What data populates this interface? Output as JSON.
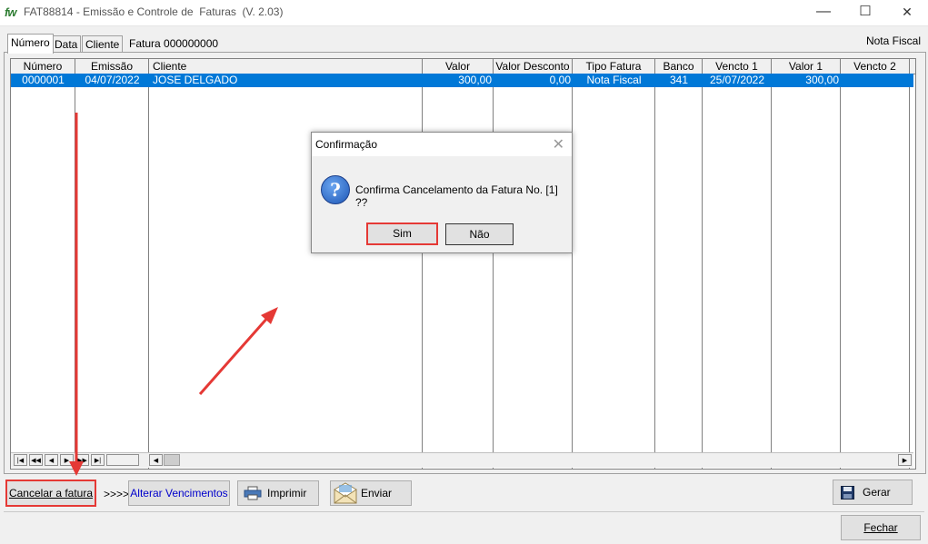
{
  "window": {
    "logo": "fw",
    "title": "FAT88814 - Emissão e Controle de  Faturas  (V. 2.03)",
    "minimize": "—",
    "maximize": "☐",
    "close": "✕"
  },
  "tabs": [
    {
      "label": "Número"
    },
    {
      "label": "Data"
    },
    {
      "label": "Cliente"
    }
  ],
  "fatura_label": "Fatura 000000000",
  "tipo_label": "Nota Fiscal",
  "grid": {
    "columns": [
      "Número",
      "Emissão",
      "Cliente",
      "Valor",
      "Valor Desconto",
      "Tipo Fatura",
      "Banco",
      "Vencto 1",
      "Valor 1",
      "Vencto 2"
    ],
    "rows": [
      [
        "0000001",
        "04/07/2022",
        "JOSE DELGADO",
        "300,00",
        "0,00",
        "Nota Fiscal",
        "341",
        "25/07/2022",
        "300,00",
        ""
      ]
    ],
    "nav": [
      "|◀",
      "◀◀",
      "◀",
      "▶",
      "▶▶",
      "▶|"
    ]
  },
  "buttons": {
    "cancelar": "Cancelar a fatura",
    "arrows_text": ">>>>",
    "alterar": "Alterar Vencimentos",
    "imprimir": "Imprimir",
    "enviar": "Enviar",
    "gerar": "Gerar",
    "fechar": "Fechar"
  },
  "dialog": {
    "title": "Confirmação",
    "message": "Confirma Cancelamento da Fatura No. [1] ??",
    "yes": "Sim",
    "no": "Não",
    "icon": "question-icon"
  },
  "colors": {
    "selection": "#0078d7",
    "annotation": "#e53935"
  }
}
